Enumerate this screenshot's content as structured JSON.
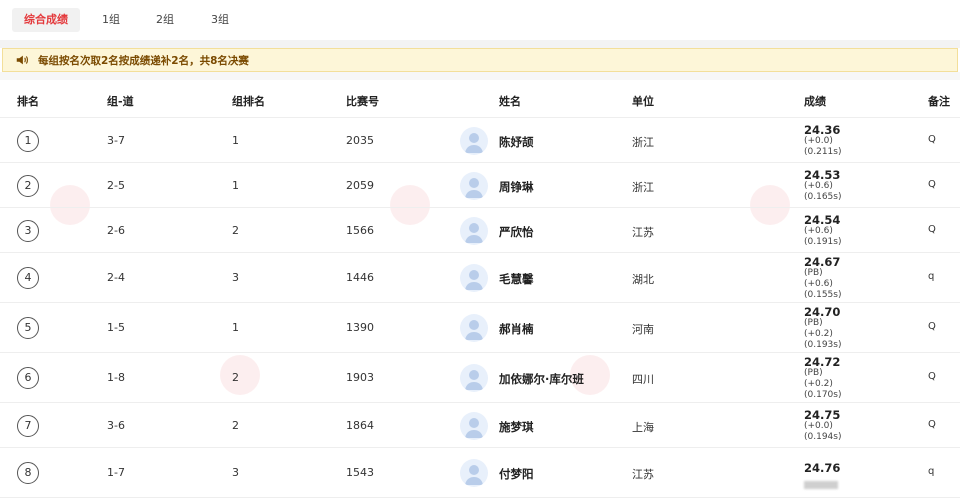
{
  "tabs": [
    {
      "label": "综合成绩",
      "active": true
    },
    {
      "label": "1组",
      "active": false
    },
    {
      "label": "2组",
      "active": false
    },
    {
      "label": "3组",
      "active": false
    }
  ],
  "notice": {
    "text": "每组按名次取2名按成绩递补2名，共8名决赛"
  },
  "table": {
    "headers": {
      "rank": "排名",
      "heat_lane": "组-道",
      "heat_rank": "组排名",
      "bib": "比赛号",
      "name": "姓名",
      "unit": "单位",
      "result": "成绩",
      "note": "备注"
    },
    "rows": [
      {
        "rank": "1",
        "heat_lane": "3-7",
        "heat_rank": "1",
        "bib": "2035",
        "name": "陈妤颉",
        "unit": "浙江",
        "result": "24.36",
        "details": [
          "(+0.0)",
          "(0.211s)"
        ],
        "note": "Q"
      },
      {
        "rank": "2",
        "heat_lane": "2-5",
        "heat_rank": "1",
        "bib": "2059",
        "name": "周铮琳",
        "unit": "浙江",
        "result": "24.53",
        "details": [
          "(+0.6)",
          "(0.165s)"
        ],
        "note": "Q"
      },
      {
        "rank": "3",
        "heat_lane": "2-6",
        "heat_rank": "2",
        "bib": "1566",
        "name": "严欣怡",
        "unit": "江苏",
        "result": "24.54",
        "details": [
          "(+0.6)",
          "(0.191s)"
        ],
        "note": "Q"
      },
      {
        "rank": "4",
        "heat_lane": "2-4",
        "heat_rank": "3",
        "bib": "1446",
        "name": "毛慧馨",
        "unit": "湖北",
        "result": "24.67",
        "details": [
          "(PB)",
          "(+0.6)",
          "(0.155s)"
        ],
        "note": "q"
      },
      {
        "rank": "5",
        "heat_lane": "1-5",
        "heat_rank": "1",
        "bib": "1390",
        "name": "郝肖楠",
        "unit": "河南",
        "result": "24.70",
        "details": [
          "(PB)",
          "(+0.2)",
          "(0.193s)"
        ],
        "note": "Q"
      },
      {
        "rank": "6",
        "heat_lane": "1-8",
        "heat_rank": "2",
        "bib": "1903",
        "name": "加依娜尔·库尔班",
        "unit": "四川",
        "result": "24.72",
        "details": [
          "(PB)",
          "(+0.2)",
          "(0.170s)"
        ],
        "note": "Q"
      },
      {
        "rank": "7",
        "heat_lane": "3-6",
        "heat_rank": "2",
        "bib": "1864",
        "name": "施梦琪",
        "unit": "上海",
        "result": "24.75",
        "details": [
          "(+0.0)",
          "(0.194s)"
        ],
        "note": "Q"
      },
      {
        "rank": "8",
        "heat_lane": "1-7",
        "heat_rank": "3",
        "bib": "1543",
        "name": "付梦阳",
        "unit": "江苏",
        "result": "24.76",
        "details": [],
        "note": "q"
      }
    ]
  },
  "colors": {
    "accent": "#e4393c",
    "notice_bg": "#fdf6d8",
    "notice_text": "#7a4a00",
    "avatar_bg": "#e8f0fb",
    "avatar_fg": "#b9cdea"
  }
}
